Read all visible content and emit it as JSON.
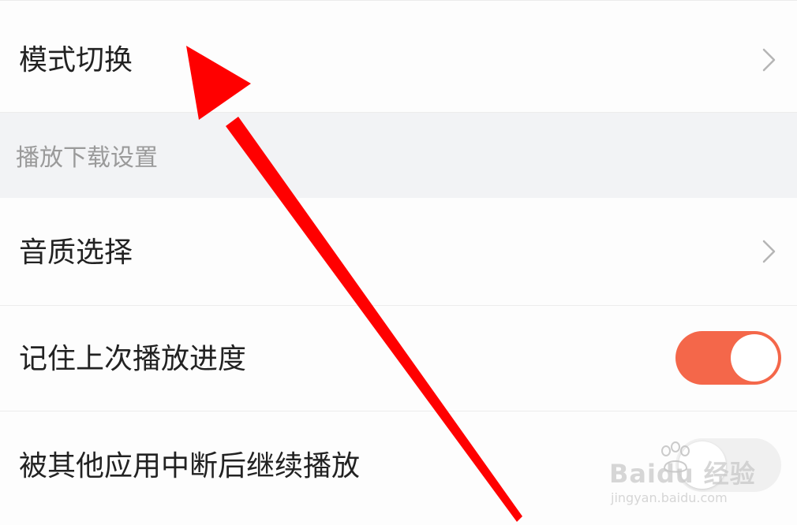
{
  "rows": {
    "mode_switch": {
      "label": "模式切换"
    },
    "section_playback_download": {
      "label": "播放下载设置"
    },
    "audio_quality": {
      "label": "音质选择"
    },
    "remember_progress": {
      "label": "记住上次播放进度",
      "toggle_on": true
    },
    "resume_after_interrupt": {
      "label": "被其他应用中断后继续播放",
      "toggle_on": false
    }
  },
  "annotation": {
    "arrow_color": "#ff0000"
  },
  "watermark": {
    "brand": "Baidu 经验",
    "url": "jingyan.baidu.com"
  },
  "colors": {
    "toggle_on": "#f4674a",
    "toggle_off": "#f0f0f0",
    "section_bg": "#f2f3f5"
  }
}
